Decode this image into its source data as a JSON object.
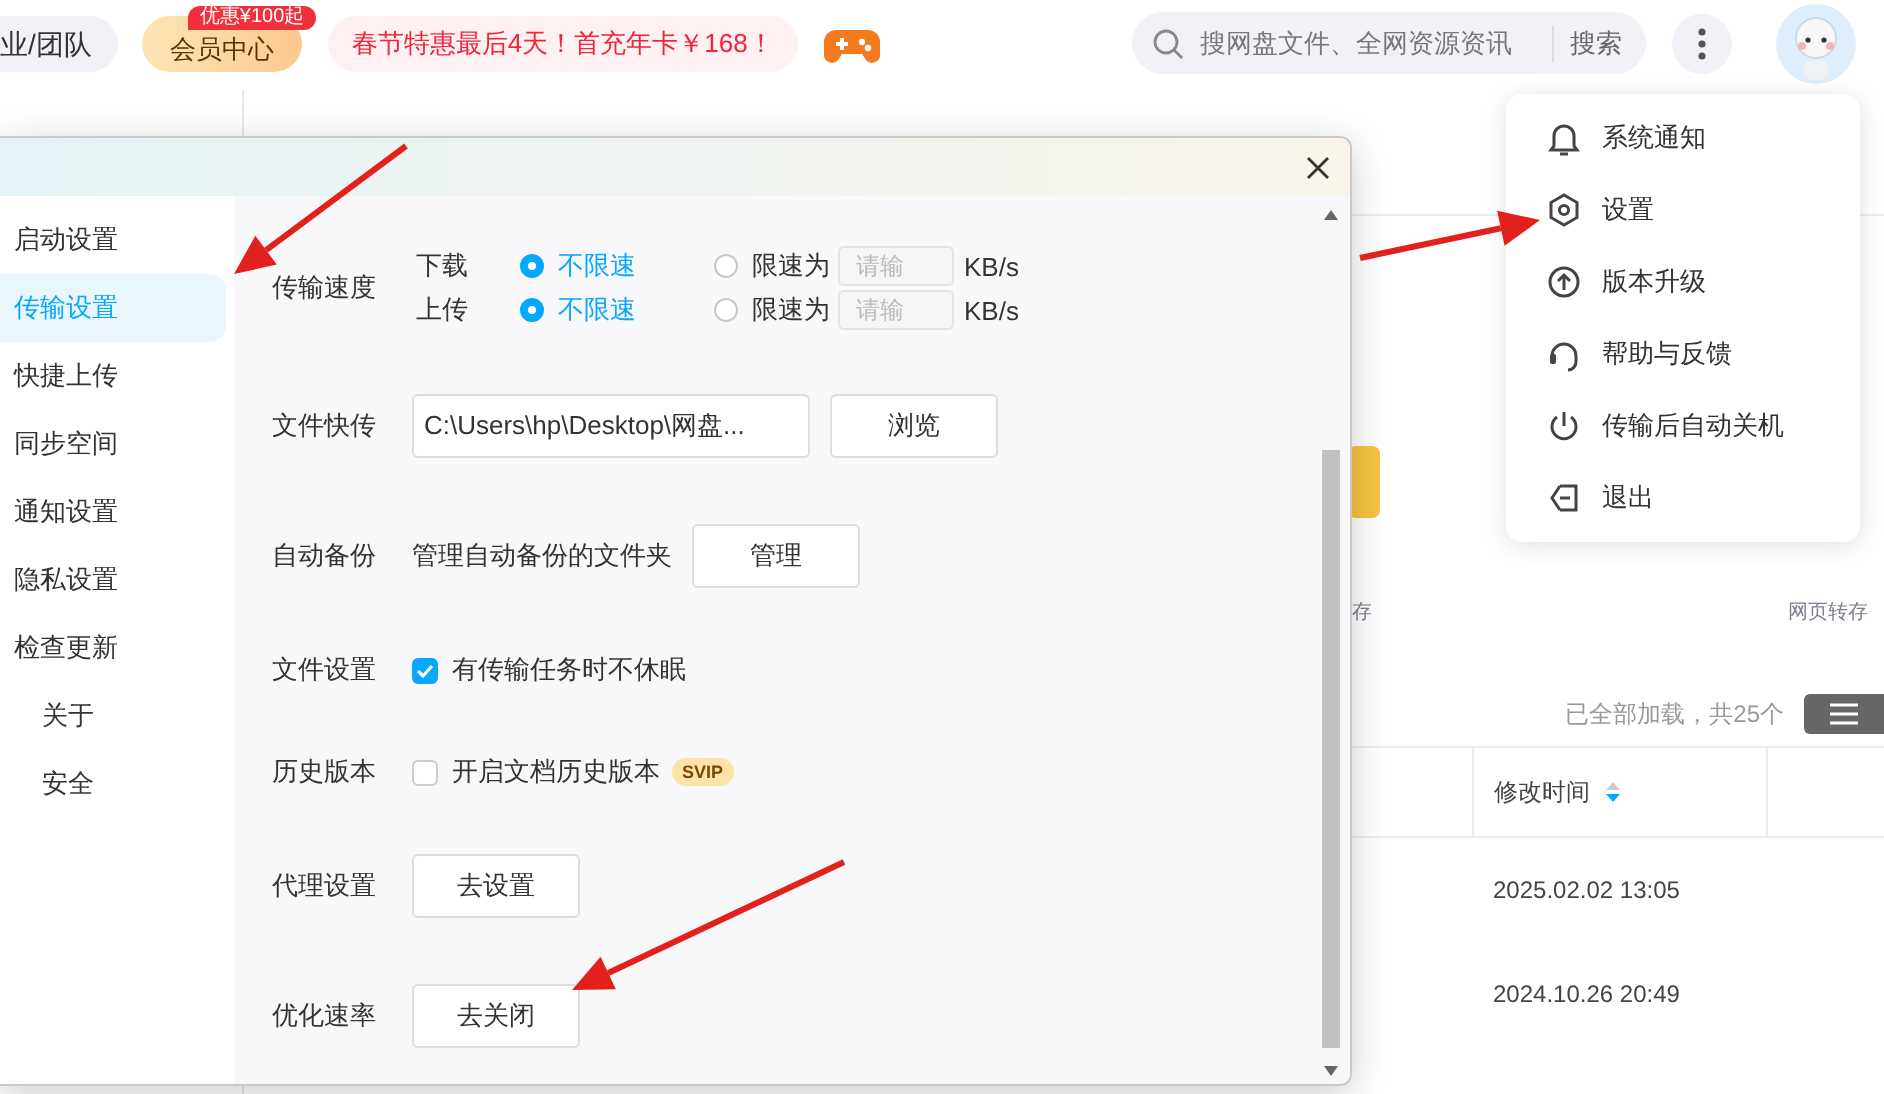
{
  "top_bar": {
    "team_button": "业/团队",
    "vip_button": {
      "label": "会员中心",
      "badge": "优惠¥100起"
    },
    "promo": "春节特惠最后4天！首充年卡￥168！",
    "search": {
      "placeholder": "搜网盘文件、全网资源资讯",
      "button": "搜索"
    }
  },
  "files_panel": {
    "shortcuts": [
      "存",
      "网页转存"
    ],
    "load_status": "已全部加载，共25个",
    "table": {
      "columns": [
        {
          "label": "修改时间",
          "sorted": true
        }
      ],
      "rows": [
        [
          "2025.02.02 13:05"
        ],
        [
          "2024.10.26 20:49"
        ]
      ]
    }
  },
  "settings_dialog": {
    "sidebar": {
      "items": [
        {
          "label": "启动设置",
          "selected": false
        },
        {
          "label": "传输设置",
          "selected": true
        },
        {
          "label": "快捷上传",
          "selected": false
        },
        {
          "label": "同步空间",
          "selected": false
        },
        {
          "label": "通知设置",
          "selected": false
        },
        {
          "label": "隐私设置",
          "selected": false
        },
        {
          "label": "检查更新",
          "selected": false,
          "children": [
            {
              "label": "关于",
              "selected": false
            },
            {
              "label": "安全",
              "selected": false
            }
          ]
        }
      ]
    },
    "sections": [
      {
        "kind": "speed",
        "label": "传输速度",
        "rows": [
          {
            "direction": "下载",
            "options": [
              {
                "label": "不限速",
                "selected": true
              },
              {
                "label": "限速为",
                "selected": false
              }
            ],
            "placeholder": "请输",
            "unit": "KB/s"
          },
          {
            "direction": "上传",
            "options": [
              {
                "label": "不限速",
                "selected": true
              },
              {
                "label": "限速为",
                "selected": false
              }
            ],
            "placeholder": "请输",
            "unit": "KB/s"
          }
        ]
      },
      {
        "kind": "path",
        "label": "文件快传",
        "value": "C:\\Users\\hp\\Desktop\\网盘...",
        "button": "浏览"
      },
      {
        "kind": "text_button",
        "label": "自动备份",
        "text": "管理自动备份的文件夹",
        "button": "管理"
      },
      {
        "kind": "checkbox",
        "label": "文件设置",
        "text": "有传输任务时不休眠",
        "checked": true
      },
      {
        "kind": "checkbox",
        "label": "历史版本",
        "text": "开启文档历史版本",
        "checked": false,
        "badge": "SVIP"
      },
      {
        "kind": "button",
        "label": "代理设置",
        "button": "去设置"
      },
      {
        "kind": "button",
        "label": "优化速率",
        "button": "去关闭"
      }
    ]
  },
  "menu": {
    "items": [
      {
        "label": "系统通知"
      },
      {
        "label": "设置"
      },
      {
        "label": "版本升级"
      },
      {
        "label": "帮助与反馈"
      },
      {
        "label": "传输后自动关机"
      },
      {
        "label": "退出"
      }
    ]
  }
}
